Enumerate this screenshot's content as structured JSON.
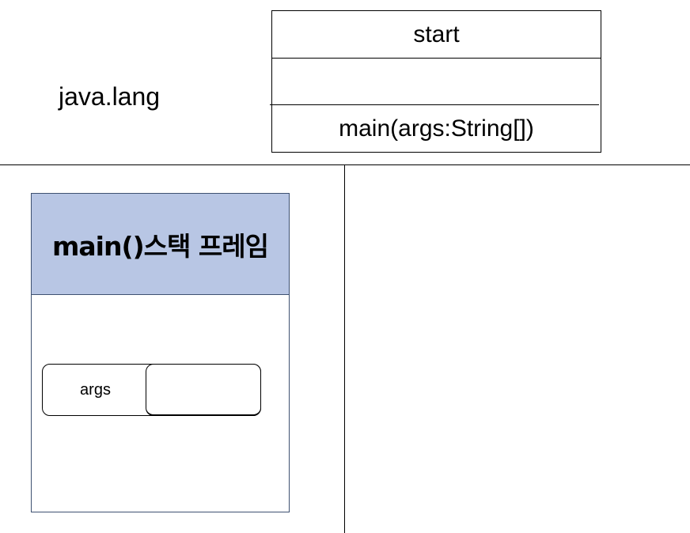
{
  "package": {
    "label": "java.lang"
  },
  "class_box": {
    "name": "start",
    "fields": "",
    "method": "main(args:String[])"
  },
  "stack_frame": {
    "title": "main()스택 프레임",
    "variable": {
      "name": "args",
      "value": ""
    }
  }
}
